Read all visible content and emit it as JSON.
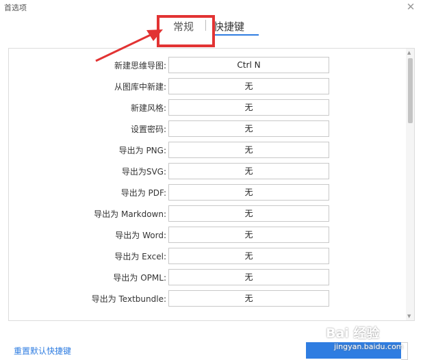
{
  "window": {
    "title": "首选项",
    "close_icon": "close-icon"
  },
  "tabs": [
    {
      "label": "常规",
      "active": false
    },
    {
      "label": "快捷键",
      "active": true
    }
  ],
  "shortcuts": [
    {
      "label": "新建思维导图:",
      "value": "Ctrl N"
    },
    {
      "label": "从图库中新建:",
      "value": "无"
    },
    {
      "label": "新建风格:",
      "value": "无"
    },
    {
      "label": "设置密码:",
      "value": "无"
    },
    {
      "label": "导出为 PNG:",
      "value": "无"
    },
    {
      "label": "导出为SVG:",
      "value": "无"
    },
    {
      "label": "导出为 PDF:",
      "value": "无"
    },
    {
      "label": "导出为 Markdown:",
      "value": "无"
    },
    {
      "label": "导出为 Word:",
      "value": "无"
    },
    {
      "label": "导出为 Excel:",
      "value": "无"
    },
    {
      "label": "导出为 OPML:",
      "value": "无"
    },
    {
      "label": "导出为 Textbundle:",
      "value": "无"
    }
  ],
  "footer": {
    "reset_label": "重置默认快捷键"
  },
  "watermark": {
    "logo": "Bai 经验",
    "url": "jingyan.baidu.com"
  },
  "colors": {
    "accent": "#2f7de1",
    "annotation": "#e23333"
  }
}
